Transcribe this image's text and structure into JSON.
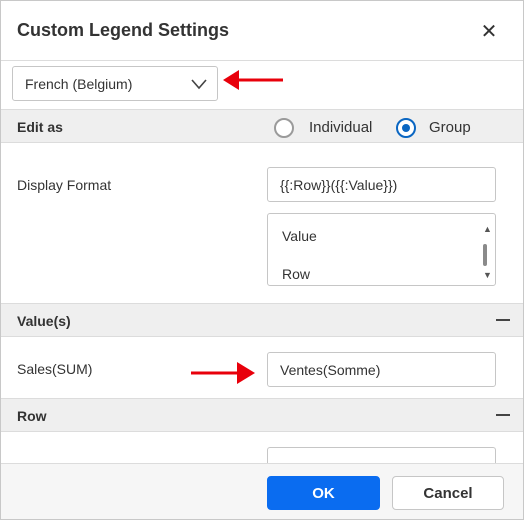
{
  "dialog": {
    "title": "Custom Legend Settings",
    "close_symbol": "✕"
  },
  "language_select": {
    "value": "French (Belgium)"
  },
  "edit_as": {
    "label": "Edit as",
    "options": [
      {
        "label": "Individual",
        "selected": false
      },
      {
        "label": "Group",
        "selected": true
      }
    ]
  },
  "display_format": {
    "label": "Display Format",
    "value": "{{:Row}}({{:Value}})",
    "fields": [
      "Value",
      "Row"
    ]
  },
  "values_section": {
    "label": "Value(s)",
    "rows": [
      {
        "label": "Sales(SUM)",
        "value": "Ventes(Somme)"
      }
    ]
  },
  "row_section": {
    "label": "Row"
  },
  "footer": {
    "ok_label": "OK",
    "cancel_label": "Cancel"
  },
  "colors": {
    "accent": "#0a6cf0",
    "annotation_arrow": "#e8000b",
    "section_bg": "#efefef"
  },
  "icons": [
    "close-icon",
    "chevron-down-icon",
    "collapse-icon",
    "scroll-up-icon",
    "scroll-down-icon",
    "arrow-annotation"
  ]
}
